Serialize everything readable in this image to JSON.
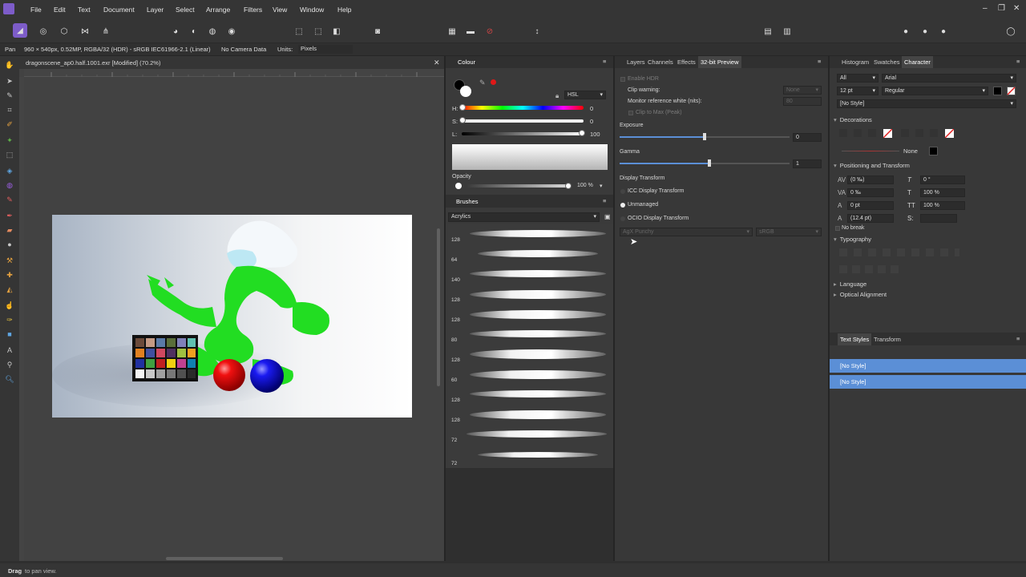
{
  "menu": {
    "items": [
      "File",
      "Edit",
      "Text",
      "Document",
      "Layer",
      "Select",
      "Arrange",
      "Filters",
      "View",
      "Window",
      "Help"
    ]
  },
  "context": {
    "tool": "Pan",
    "info": "960 × 540px, 0.52MP, RGBA/32 (HDR) - sRGB IEC61966-2.1 (Linear)",
    "camera": "No Camera Data",
    "units_label": "Units:",
    "units_value": "Pixels"
  },
  "document": {
    "tab_title": "dragonscene_ap0.half.1001.exr [Modified] (70.2%)"
  },
  "colour": {
    "title": "Colour",
    "model": "HSL",
    "h_label": "H:",
    "h_value": "0",
    "s_label": "S:",
    "s_value": "0",
    "l_label": "L:",
    "l_value": "100",
    "opacity_label": "Opacity",
    "opacity_value": "100 %"
  },
  "brushes": {
    "title": "Brushes",
    "category": "Acrylics",
    "sizes": [
      "128",
      "64",
      "140",
      "128",
      "128",
      "80",
      "128",
      "60",
      "128",
      "128",
      "72",
      "72"
    ]
  },
  "preview": {
    "tabs": [
      "Layers",
      "Channels",
      "Effects",
      "32-bit Preview"
    ],
    "enable_hdr": "Enable HDR",
    "clip_warning": "Clip warning:",
    "clip_value": "None",
    "monitor_ref": "Monitor reference white (nits):",
    "monitor_value": "80",
    "clip_max": "Clip to Max (Peak)",
    "exposure_label": "Exposure",
    "exposure_value": "0",
    "gamma_label": "Gamma",
    "gamma_value": "1",
    "display_transform": "Display Transform",
    "icc": "ICC Display Transform",
    "unmanaged": "Unmanaged",
    "ocio": "OCIO Display Transform",
    "ocio_view": "AgX Punchy",
    "ocio_space": "sRGB"
  },
  "character": {
    "tabs": [
      "Histogram",
      "Swatches",
      "Character"
    ],
    "scope": "All",
    "font": "Arial",
    "size": "12 pt",
    "style": "Regular",
    "para_style": "[No Style]",
    "decorations": "Decorations",
    "decor_none": "None",
    "positioning": "Positioning and Transform",
    "pt_values": [
      "(0 ‰)",
      "0 °",
      "0 ‰",
      "100 %",
      "0 pt",
      "100 %",
      "(12.4 pt)",
      ""
    ],
    "no_break": "No break",
    "typography": "Typography",
    "language": "Language",
    "optical": "Optical Alignment"
  },
  "text_styles": {
    "tabs": [
      "Text Styles",
      "Transform"
    ],
    "items": [
      "[No Style]",
      "[No Style]"
    ]
  },
  "status": {
    "bold": "Drag",
    "text": "to pan view."
  }
}
